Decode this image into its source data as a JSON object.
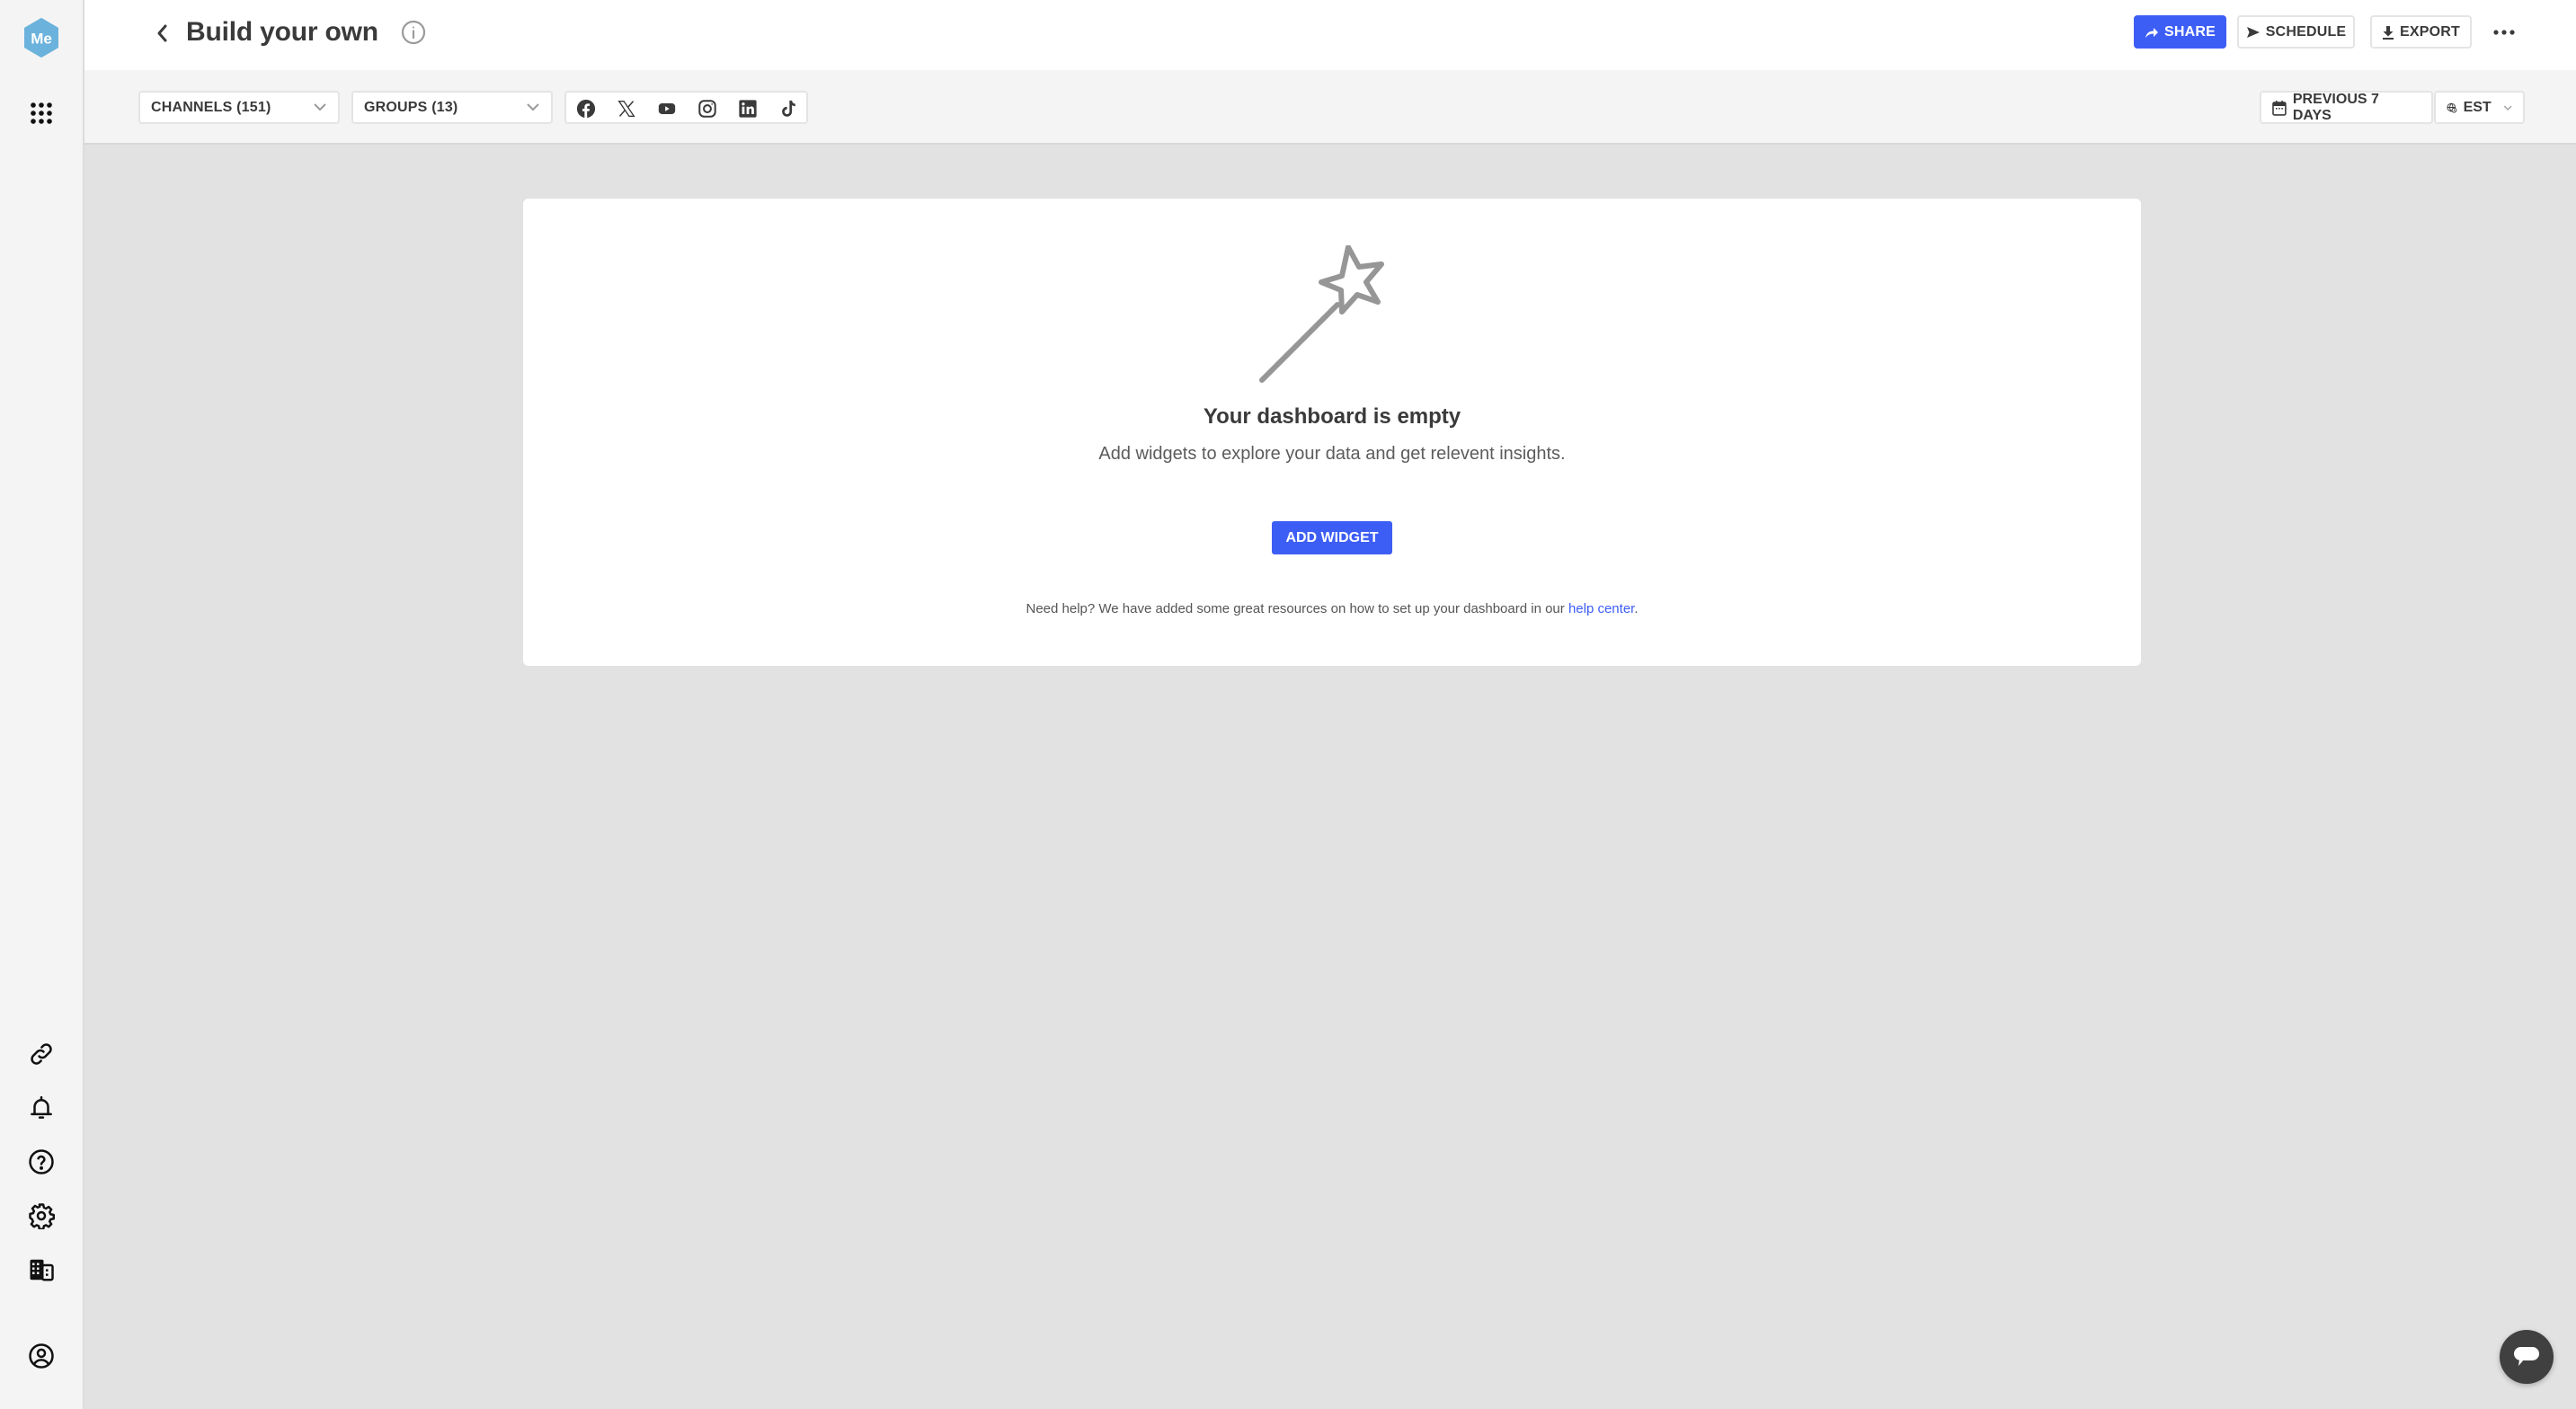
{
  "sidebar": {
    "logo_text": "Me",
    "logo_color": "#6bb2dc",
    "top_items": [
      {
        "name": "apps-grid",
        "icon": "grid-icon"
      }
    ],
    "bottom_items": [
      {
        "name": "links",
        "icon": "link-icon"
      },
      {
        "name": "notifications",
        "icon": "bell-icon"
      },
      {
        "name": "help",
        "icon": "help-circle-icon"
      },
      {
        "name": "settings",
        "icon": "gear-icon"
      },
      {
        "name": "organization",
        "icon": "building-icon"
      },
      {
        "name": "profile",
        "icon": "user-circle-icon"
      }
    ]
  },
  "header": {
    "title": "Build your own",
    "buttons": {
      "share": "SHARE",
      "schedule": "SCHEDULE",
      "export": "EXPORT"
    },
    "accent_color": "#3d5ef5"
  },
  "filters": {
    "channels": "CHANNELS (151)",
    "groups": "GROUPS (13)",
    "networks": [
      "facebook",
      "x",
      "youtube",
      "instagram",
      "linkedin",
      "tiktok"
    ],
    "date_range": "PREVIOUS 7 DAYS",
    "timezone": "EST"
  },
  "empty_state": {
    "title": "Your dashboard is empty",
    "subtitle": "Add widgets to explore your data and get relevent insights.",
    "button": "ADD WIDGET",
    "help_prefix": "Need help? We have added some great resources on how to set up your dashboard in our ",
    "help_link": "help center",
    "help_suffix": "."
  }
}
